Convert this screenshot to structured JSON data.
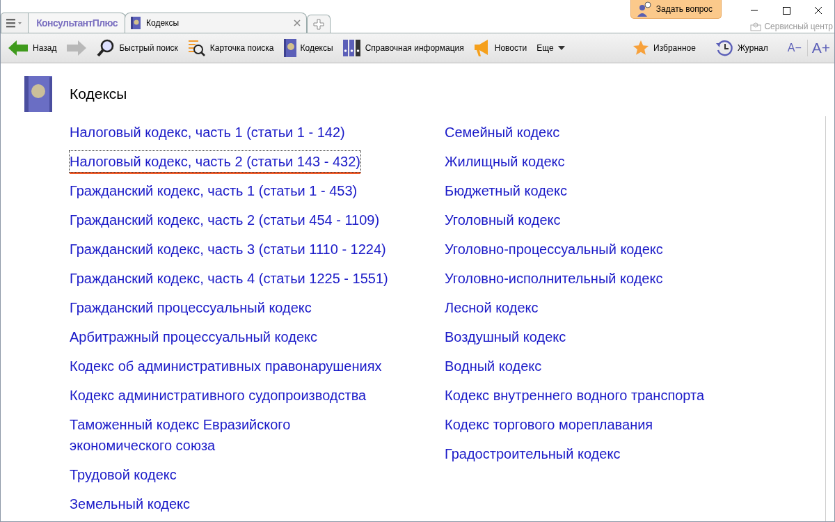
{
  "app_tab": {
    "label": "КонсультантПлюс"
  },
  "tabs": [
    {
      "label": "Кодексы",
      "selected": true
    }
  ],
  "ask_button": {
    "label": "Задать вопрос"
  },
  "service_center": {
    "label": "Сервисный центр"
  },
  "toolbar_left": [
    {
      "kind": "back",
      "label": "Назад",
      "disabled": false
    },
    {
      "kind": "forward",
      "disabled": true
    },
    {
      "kind": "quick-search",
      "label": "Быстрый поиск",
      "disabled": false
    },
    {
      "kind": "search-card",
      "label": "Карточка поиска",
      "disabled": false
    },
    {
      "kind": "codes",
      "label": "Кодексы",
      "disabled": false
    },
    {
      "kind": "reference",
      "label": "Справочная информация",
      "disabled": false
    },
    {
      "kind": "news",
      "label": "Новости",
      "disabled": false
    },
    {
      "kind": "more",
      "label": "Еще",
      "disabled": false
    }
  ],
  "toolbar_right": [
    {
      "kind": "favorites",
      "label": "Избранное",
      "disabled": false
    },
    {
      "kind": "journal",
      "label": "Журнал",
      "disabled": false
    }
  ],
  "font_buttons": [
    {
      "label": "A−",
      "kind": "smaller"
    },
    {
      "label": "A+",
      "kind": "larger"
    }
  ],
  "heading": "Кодексы",
  "columns": [
    [
      {
        "label": "Налоговый кодекс, часть 1 (статьи 1 - 142)",
        "selected": false
      },
      {
        "label": "Налоговый кодекс, часть 2 (статьи 143 - 432)",
        "selected": true
      },
      {
        "label": "Гражданский кодекс, часть 1 (статьи 1 - 453)",
        "selected": false
      },
      {
        "label": "Гражданский кодекс, часть 2 (статьи 454 - 1109)",
        "selected": false
      },
      {
        "label": "Гражданский кодекс, часть 3 (статьи 1110 - 1224)",
        "selected": false
      },
      {
        "label": "Гражданский кодекс, часть 4 (статьи 1225 - 1551)",
        "selected": false
      },
      {
        "label": "Гражданский процессуальный кодекс",
        "selected": false
      },
      {
        "label": "Арбитражный процессуальный кодекс",
        "selected": false
      },
      {
        "label": "Кодекс об административных правонарушениях",
        "selected": false
      },
      {
        "label": "Кодекс административного судопроизводства",
        "selected": false
      },
      {
        "label": "Таможенный кодекс Евразийского экономического союза",
        "selected": false
      },
      {
        "label": "Трудовой кодекс",
        "selected": false
      },
      {
        "label": "Земельный кодекс",
        "selected": false
      }
    ],
    [
      {
        "label": "Семейный кодекс",
        "selected": false
      },
      {
        "label": "Жилищный кодекс",
        "selected": false
      },
      {
        "label": "Бюджетный кодекс",
        "selected": false
      },
      {
        "label": "Уголовный кодекс",
        "selected": false
      },
      {
        "label": "Уголовно-процессуальный кодекс",
        "selected": false
      },
      {
        "label": "Уголовно-исполнительный кодекс",
        "selected": false
      },
      {
        "label": "Лесной кодекс",
        "selected": false
      },
      {
        "label": "Воздушный кодекс",
        "selected": false
      },
      {
        "label": "Водный кодекс",
        "selected": false
      },
      {
        "label": "Кодекс внутреннего водного транспорта",
        "selected": false
      },
      {
        "label": "Кодекс торгового мореплавания",
        "selected": false
      },
      {
        "label": "Градостроительный кодекс",
        "selected": false
      }
    ]
  ]
}
